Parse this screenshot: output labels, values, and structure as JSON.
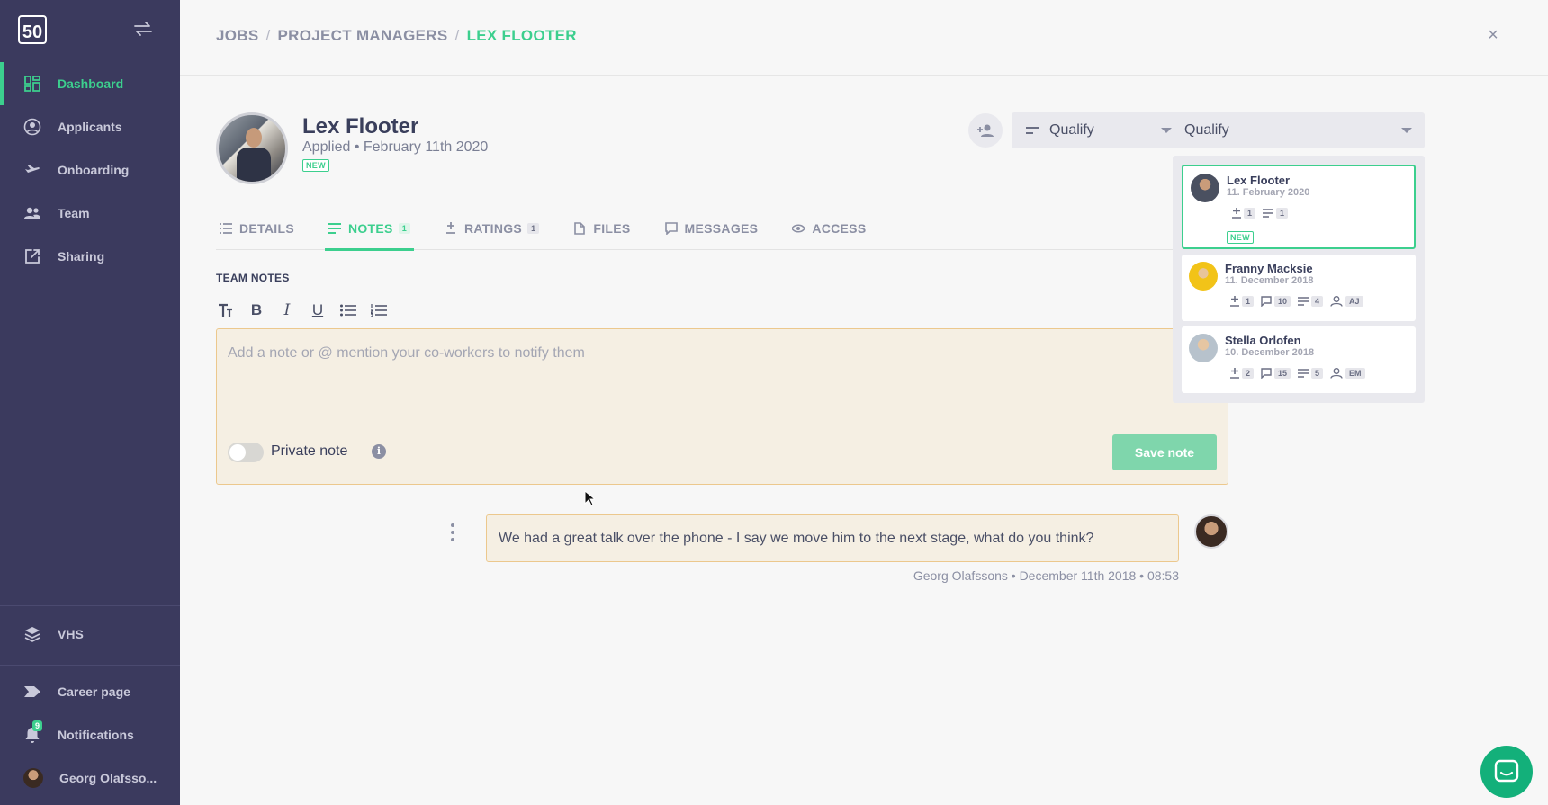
{
  "sidebar": {
    "logo_text": "50",
    "nav": [
      {
        "label": "Dashboard",
        "icon": "dashboard-icon",
        "active": true
      },
      {
        "label": "Applicants",
        "icon": "user-circle-icon"
      },
      {
        "label": "Onboarding",
        "icon": "plane-icon"
      },
      {
        "label": "Team",
        "icon": "team-icon"
      },
      {
        "label": "Sharing",
        "icon": "share-icon"
      }
    ],
    "bottom": [
      {
        "label": "VHS",
        "icon": "layers-icon"
      },
      {
        "label": "Career page",
        "icon": "tag-icon"
      },
      {
        "label": "Notifications",
        "icon": "bell-icon",
        "badge": "9"
      },
      {
        "label": "Georg Olafsso...",
        "icon": "avatar"
      }
    ]
  },
  "breadcrumb": {
    "items": [
      "JOBS",
      "PROJECT MANAGERS"
    ],
    "current": "LEX FLOOTER",
    "sep": "/"
  },
  "close_label": "×",
  "profile": {
    "name": "Lex Flooter",
    "applied": "Applied • February 11th 2020",
    "badge": "NEW",
    "stage": "Qualify"
  },
  "tabs": [
    {
      "label": "DETAILS",
      "icon": "list-icon"
    },
    {
      "label": "NOTES",
      "icon": "notes-icon",
      "count": "1",
      "active": true
    },
    {
      "label": "RATINGS",
      "icon": "rating-icon",
      "count": "1"
    },
    {
      "label": "FILES",
      "icon": "file-icon"
    },
    {
      "label": "MESSAGES",
      "icon": "message-icon"
    },
    {
      "label": "ACCESS",
      "icon": "eye-icon"
    }
  ],
  "notes": {
    "section_title": "TEAM NOTES",
    "placeholder": "Add a note or @ mention your co-workers to notify them",
    "private_label": "Private note",
    "private_enabled": false,
    "save_label": "Save note",
    "comment": {
      "text": "We had a great talk over the phone - I say we move him to the next stage, what do you think?",
      "meta": "Georg Olafssons • December 11th 2018 • 08:53"
    }
  },
  "right_panel": {
    "stage": "Qualify",
    "candidates": [
      {
        "name": "Lex Flooter",
        "date": "11. February 2020",
        "ratings": "1",
        "notes": "1",
        "badge": "NEW",
        "selected": true
      },
      {
        "name": "Franny Macksie",
        "date": "11. December 2018",
        "ratings": "1",
        "messages": "10",
        "notes": "4",
        "assignee": "AJ"
      },
      {
        "name": "Stella Orlofen",
        "date": "10. December 2018",
        "ratings": "2",
        "messages": "15",
        "notes": "5",
        "assignee": "EM"
      }
    ]
  },
  "colors": {
    "accent": "#3ccf8e",
    "sidebar": "#3b3a5e",
    "note_bg": "#f5efe3",
    "note_border": "#ecc88d"
  }
}
